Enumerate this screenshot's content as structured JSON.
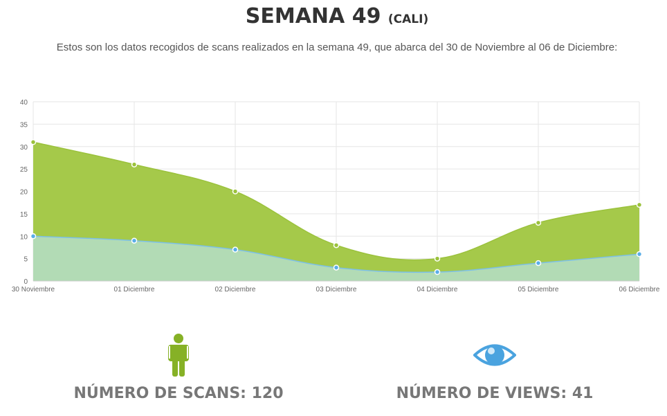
{
  "header": {
    "title": "SEMANA 49",
    "title_suffix": "(CALI)",
    "description": "Estos son los datos recogidos de scans realizados en la semana 49, que abarca del 30 de Noviembre al 06 de Diciembre:"
  },
  "chart_data": {
    "type": "area",
    "categories": [
      "30 Noviembre",
      "01 Diciembre",
      "02 Diciembre",
      "03 Diciembre",
      "04 Diciembre",
      "05 Diciembre",
      "06 Diciembre"
    ],
    "ylim": [
      0,
      40
    ],
    "yticks": [
      0,
      5,
      10,
      15,
      20,
      25,
      30,
      35,
      40
    ],
    "grid": true,
    "series": [
      {
        "values": [
          31,
          26,
          20,
          8,
          5,
          13,
          17
        ],
        "fill": "#a5c94a",
        "stroke": "#9bc23c",
        "point": "#9bc23c"
      },
      {
        "values": [
          10,
          9,
          7,
          3,
          2,
          4,
          6
        ],
        "fill": "#b2dbb5",
        "stroke": "#7cc0e8",
        "point": "#5aaee8"
      }
    ]
  },
  "stats": {
    "scans": {
      "label": "NÚMERO DE SCANS: 120",
      "icon": "person-icon",
      "color": "#86b126"
    },
    "views": {
      "label": "NÚMERO DE VIEWS: 41",
      "icon": "eye-icon",
      "color": "#4aa3df"
    }
  }
}
